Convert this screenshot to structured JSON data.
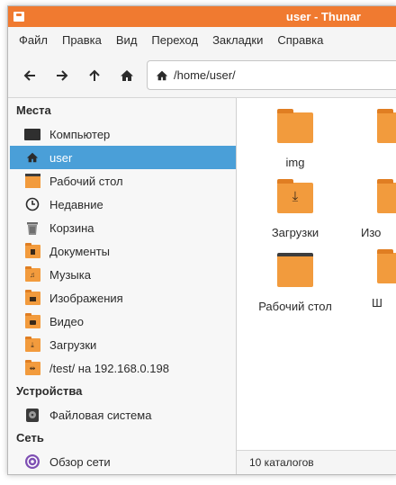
{
  "window": {
    "title": "user - Thunar"
  },
  "menu": [
    "Файл",
    "Правка",
    "Вид",
    "Переход",
    "Закладки",
    "Справка"
  ],
  "location": {
    "path": "/home/user/"
  },
  "sidebar": {
    "places_header": "Места",
    "places": [
      {
        "label": "Компьютер",
        "icon": "computer-icon"
      },
      {
        "label": "user",
        "icon": "home-icon"
      },
      {
        "label": "Рабочий стол",
        "icon": "desktop-icon"
      },
      {
        "label": "Недавние",
        "icon": "clock-icon"
      },
      {
        "label": "Корзина",
        "icon": "trash-icon"
      },
      {
        "label": "Документы",
        "icon": "documents-folder-icon"
      },
      {
        "label": "Музыка",
        "icon": "music-folder-icon"
      },
      {
        "label": "Изображения",
        "icon": "pictures-folder-icon"
      },
      {
        "label": "Видео",
        "icon": "video-folder-icon"
      },
      {
        "label": "Загрузки",
        "icon": "downloads-folder-icon"
      },
      {
        "label": "/test/ на 192.168.0.198",
        "icon": "network-folder-icon"
      }
    ],
    "devices_header": "Устройства",
    "devices": [
      {
        "label": "Файловая система",
        "icon": "drive-icon"
      }
    ],
    "network_header": "Сеть",
    "network": [
      {
        "label": "Обзор сети",
        "icon": "network-icon"
      }
    ]
  },
  "files": [
    {
      "name": "img",
      "icon": "folder-icon"
    },
    {
      "name": "Загрузки",
      "icon": "downloads-folder-icon"
    },
    {
      "name": "Рабочий стол",
      "icon": "desktop-folder-icon"
    }
  ],
  "files_partial": [
    "Изо",
    "Ш"
  ],
  "status": "10 каталогов",
  "colors": {
    "titlebar": "#f07a30",
    "selection": "#4a9fd8",
    "folder": "#f29b3d"
  }
}
